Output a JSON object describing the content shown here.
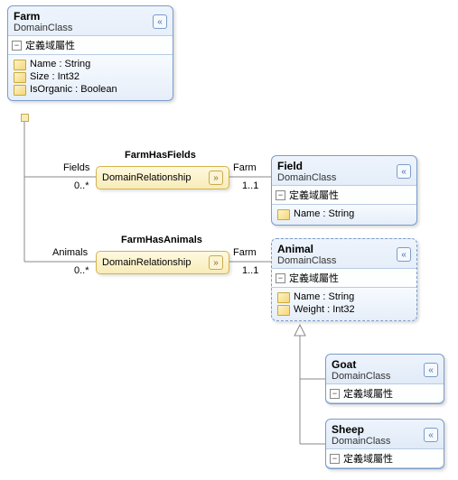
{
  "farm": {
    "name": "Farm",
    "type": "DomainClass",
    "section": "定義域屬性",
    "props": [
      {
        "label": "Name : String"
      },
      {
        "label": "Size : Int32"
      },
      {
        "label": "IsOrganic : Boolean"
      }
    ]
  },
  "field": {
    "name": "Field",
    "type": "DomainClass",
    "section": "定義域屬性",
    "props": [
      {
        "label": "Name : String"
      }
    ]
  },
  "animal": {
    "name": "Animal",
    "type": "DomainClass",
    "section": "定義域屬性",
    "props": [
      {
        "label": "Name : String"
      },
      {
        "label": "Weight : Int32"
      }
    ]
  },
  "goat": {
    "name": "Goat",
    "type": "DomainClass",
    "section": "定義域屬性"
  },
  "sheep": {
    "name": "Sheep",
    "type": "DomainClass",
    "section": "定義域屬性"
  },
  "rel1": {
    "title": "FarmHasFields",
    "label": "DomainRelationship",
    "roleLeft": "Fields",
    "multLeft": "0..*",
    "roleRight": "Farm",
    "multRight": "1..1"
  },
  "rel2": {
    "title": "FarmHasAnimals",
    "label": "DomainRelationship",
    "roleLeft": "Animals",
    "multLeft": "0..*",
    "roleRight": "Farm",
    "multRight": "1..1"
  },
  "glyphs": {
    "collapse": "«",
    "expand": "»",
    "minus": "−"
  }
}
